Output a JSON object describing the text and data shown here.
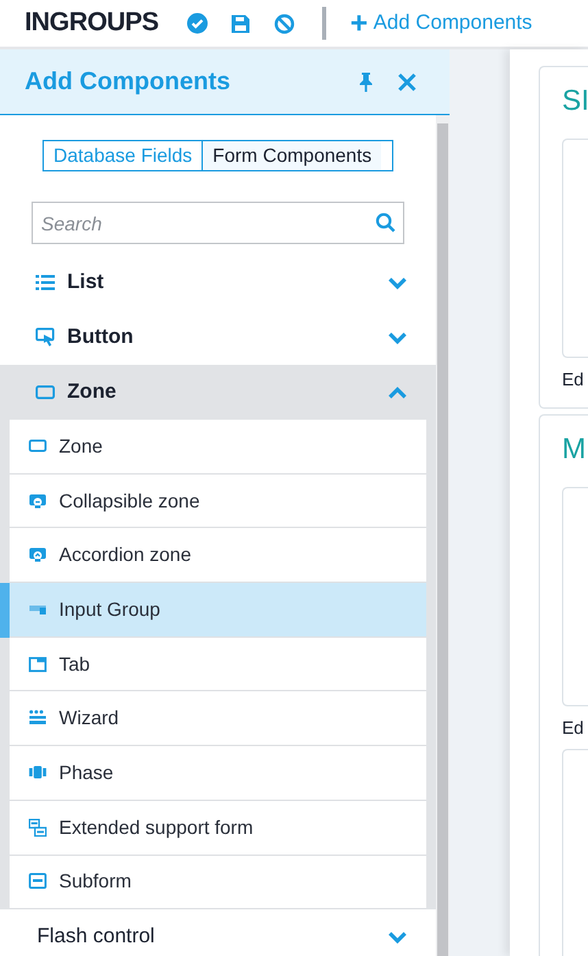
{
  "app": {
    "title": "INGROUPS",
    "add_action": {
      "icon_text": "+",
      "label": "Add Components"
    }
  },
  "panel": {
    "title": "Add Components",
    "tabs": [
      {
        "label": "Database Fields",
        "selected": false
      },
      {
        "label": "Form Components",
        "selected": true
      }
    ],
    "search": {
      "placeholder": "Search"
    },
    "categories": [
      {
        "label": "List",
        "expanded": false
      },
      {
        "label": "Button",
        "expanded": false
      },
      {
        "label": "Zone",
        "expanded": true,
        "items": [
          {
            "label": "Zone",
            "selected": false
          },
          {
            "label": "Collapsible zone",
            "selected": false
          },
          {
            "label": "Accordion zone",
            "selected": false
          },
          {
            "label": "Input Group",
            "selected": true
          },
          {
            "label": "Tab",
            "selected": false
          },
          {
            "label": "Wizard",
            "selected": false
          },
          {
            "label": "Phase",
            "selected": false
          },
          {
            "label": "Extended support form",
            "selected": false
          },
          {
            "label": "Subform",
            "selected": false
          }
        ]
      },
      {
        "label": "Flash control",
        "expanded": false
      }
    ]
  },
  "canvas": {
    "cards": [
      {
        "title": "SI",
        "caption": "Ed"
      },
      {
        "title": "M",
        "caption": "Ed"
      }
    ]
  }
}
